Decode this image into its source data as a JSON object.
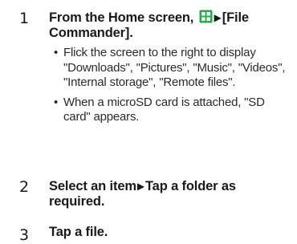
{
  "steps": [
    {
      "number": "1",
      "instruction_prefix": "From the Home screen, ",
      "icon": "apps-grid-icon",
      "arrow": "▶",
      "instruction_suffix": "[File Commander].",
      "bullets": [
        "Flick the screen to the right to display \"Downloads\", \"Pictures\", \"Music\", \"Videos\", \"Internal storage\", \"Remote files\".",
        "When a microSD card is attached, \"SD card\" appears."
      ]
    },
    {
      "number": "2",
      "instruction_part1": "Select an item",
      "arrow": "▶",
      "instruction_part2": "Tap a folder as required."
    },
    {
      "number": "3",
      "instruction": "Tap a file."
    }
  ],
  "colors": {
    "icon_green": "#2aa84a",
    "text": "#1a1a1a"
  }
}
